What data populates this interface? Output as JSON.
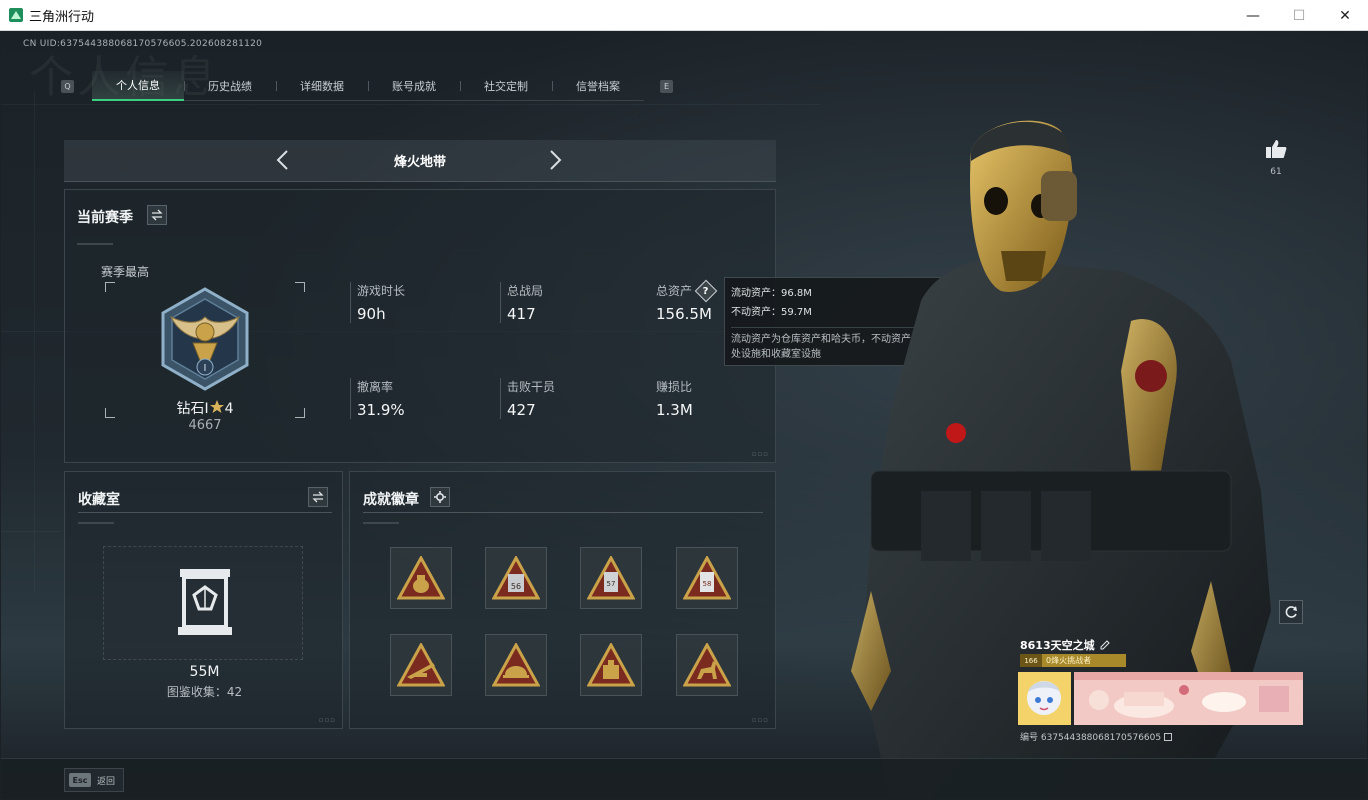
{
  "window": {
    "title": "三角洲行动",
    "controls": [
      "—",
      "☐",
      "✕"
    ]
  },
  "header": {
    "uid": "CN UID:637544388068170576605.202608281120",
    "faint_title": "个人信息",
    "key_left": "Q",
    "key_right": "E"
  },
  "tabs": [
    {
      "label": "个人信息",
      "active": true
    },
    {
      "label": "历史战绩"
    },
    {
      "label": "详细数据"
    },
    {
      "label": "账号成就"
    },
    {
      "label": "社交定制"
    },
    {
      "label": "信誉档案"
    }
  ],
  "mode": {
    "title": "烽火地带"
  },
  "season": {
    "title": "当前赛季",
    "best_label": "赛季最高",
    "rank_name": "钻石Ⅰ",
    "rank_stars": "4",
    "rank_score": "4667",
    "stats": [
      {
        "label": "游戏时长",
        "value": "90h"
      },
      {
        "label": "总战局",
        "value": "417"
      },
      {
        "label": "总资产",
        "value": "156.5M"
      },
      {
        "label": "撤离率",
        "value": "31.9%"
      },
      {
        "label": "击败干员",
        "value": "427"
      },
      {
        "label": "赚损比",
        "value": "1.3M"
      }
    ]
  },
  "tooltip": {
    "liquid": "流动资产：96.8M",
    "fixed": "不动资产：59.7M",
    "desc": "流动资产为仓库资产和哈夫币，不动资产为特勤处设施和收藏室设施"
  },
  "collection": {
    "title": "收藏室",
    "value": "55M",
    "count_label": "图鉴收集：42"
  },
  "achievements": {
    "title": "成就徽章",
    "badges": [
      "money-bag-badge-icon",
      "vest-56-badge-icon",
      "card-57-badge-icon",
      "card-58-badge-icon",
      "rifle-badge-icon",
      "helmet-badge-icon",
      "weight-badge-icon",
      "deer-badge-icon"
    ],
    "badge_numbers": [
      "",
      "56",
      "57",
      "58",
      "",
      "",
      "",
      ""
    ]
  },
  "player": {
    "likes": "61",
    "name": "8613天空之城",
    "title_level": "166",
    "title_text": "0烽火挑战者",
    "id_label": "编号 637544388068170576605"
  },
  "footer": {
    "esc": "Esc",
    "back": "返回"
  },
  "colors": {
    "accent": "#3ccf82",
    "gold": "#c9a24a",
    "panel_border": "#3b464c"
  }
}
